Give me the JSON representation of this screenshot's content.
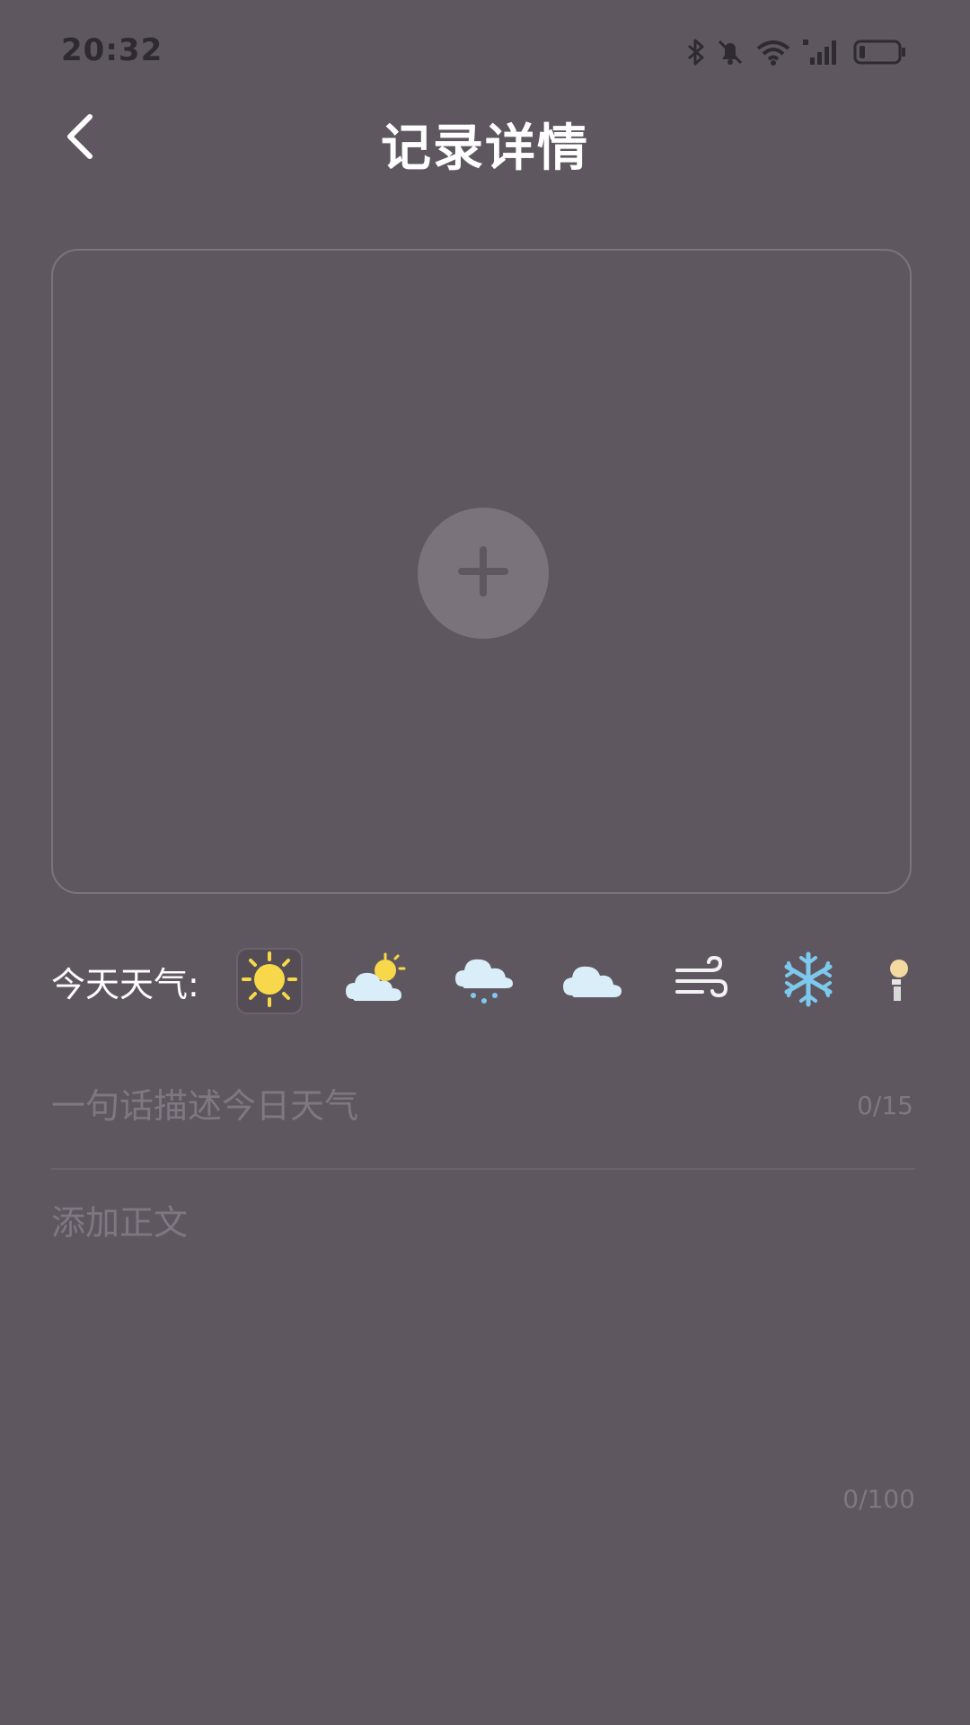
{
  "status_bar": {
    "time": "20:32",
    "icons": [
      "bluetooth-icon",
      "mute-bell-icon",
      "wifi-icon",
      "signal-icon",
      "battery-icon"
    ]
  },
  "header": {
    "title": "记录详情",
    "back_icon": "chevron-left-icon"
  },
  "photo": {
    "add_icon": "plus-icon"
  },
  "weather": {
    "label": "今天天气:",
    "options": [
      {
        "name": "sunny",
        "icon": "sun-icon",
        "selected": true
      },
      {
        "name": "partly-cloudy",
        "icon": "partly-cloudy-icon",
        "selected": false
      },
      {
        "name": "rain-snow",
        "icon": "rain-snow-icon",
        "selected": false
      },
      {
        "name": "cloudy",
        "icon": "cloud-icon",
        "selected": false
      },
      {
        "name": "windy",
        "icon": "wind-icon",
        "selected": false
      },
      {
        "name": "snow",
        "icon": "snowflake-icon",
        "selected": false
      },
      {
        "name": "other",
        "icon": "partial-icon",
        "selected": false
      }
    ]
  },
  "summary": {
    "placeholder": "一句话描述今日天气",
    "value": "",
    "counter": "0/15"
  },
  "body": {
    "placeholder": "添加正文",
    "value": "",
    "counter": "0/100"
  },
  "colors": {
    "background": "#5e5760",
    "sun": "#f7d84a",
    "cloud": "#d9eef9",
    "snowflake": "#7ec8ee"
  }
}
